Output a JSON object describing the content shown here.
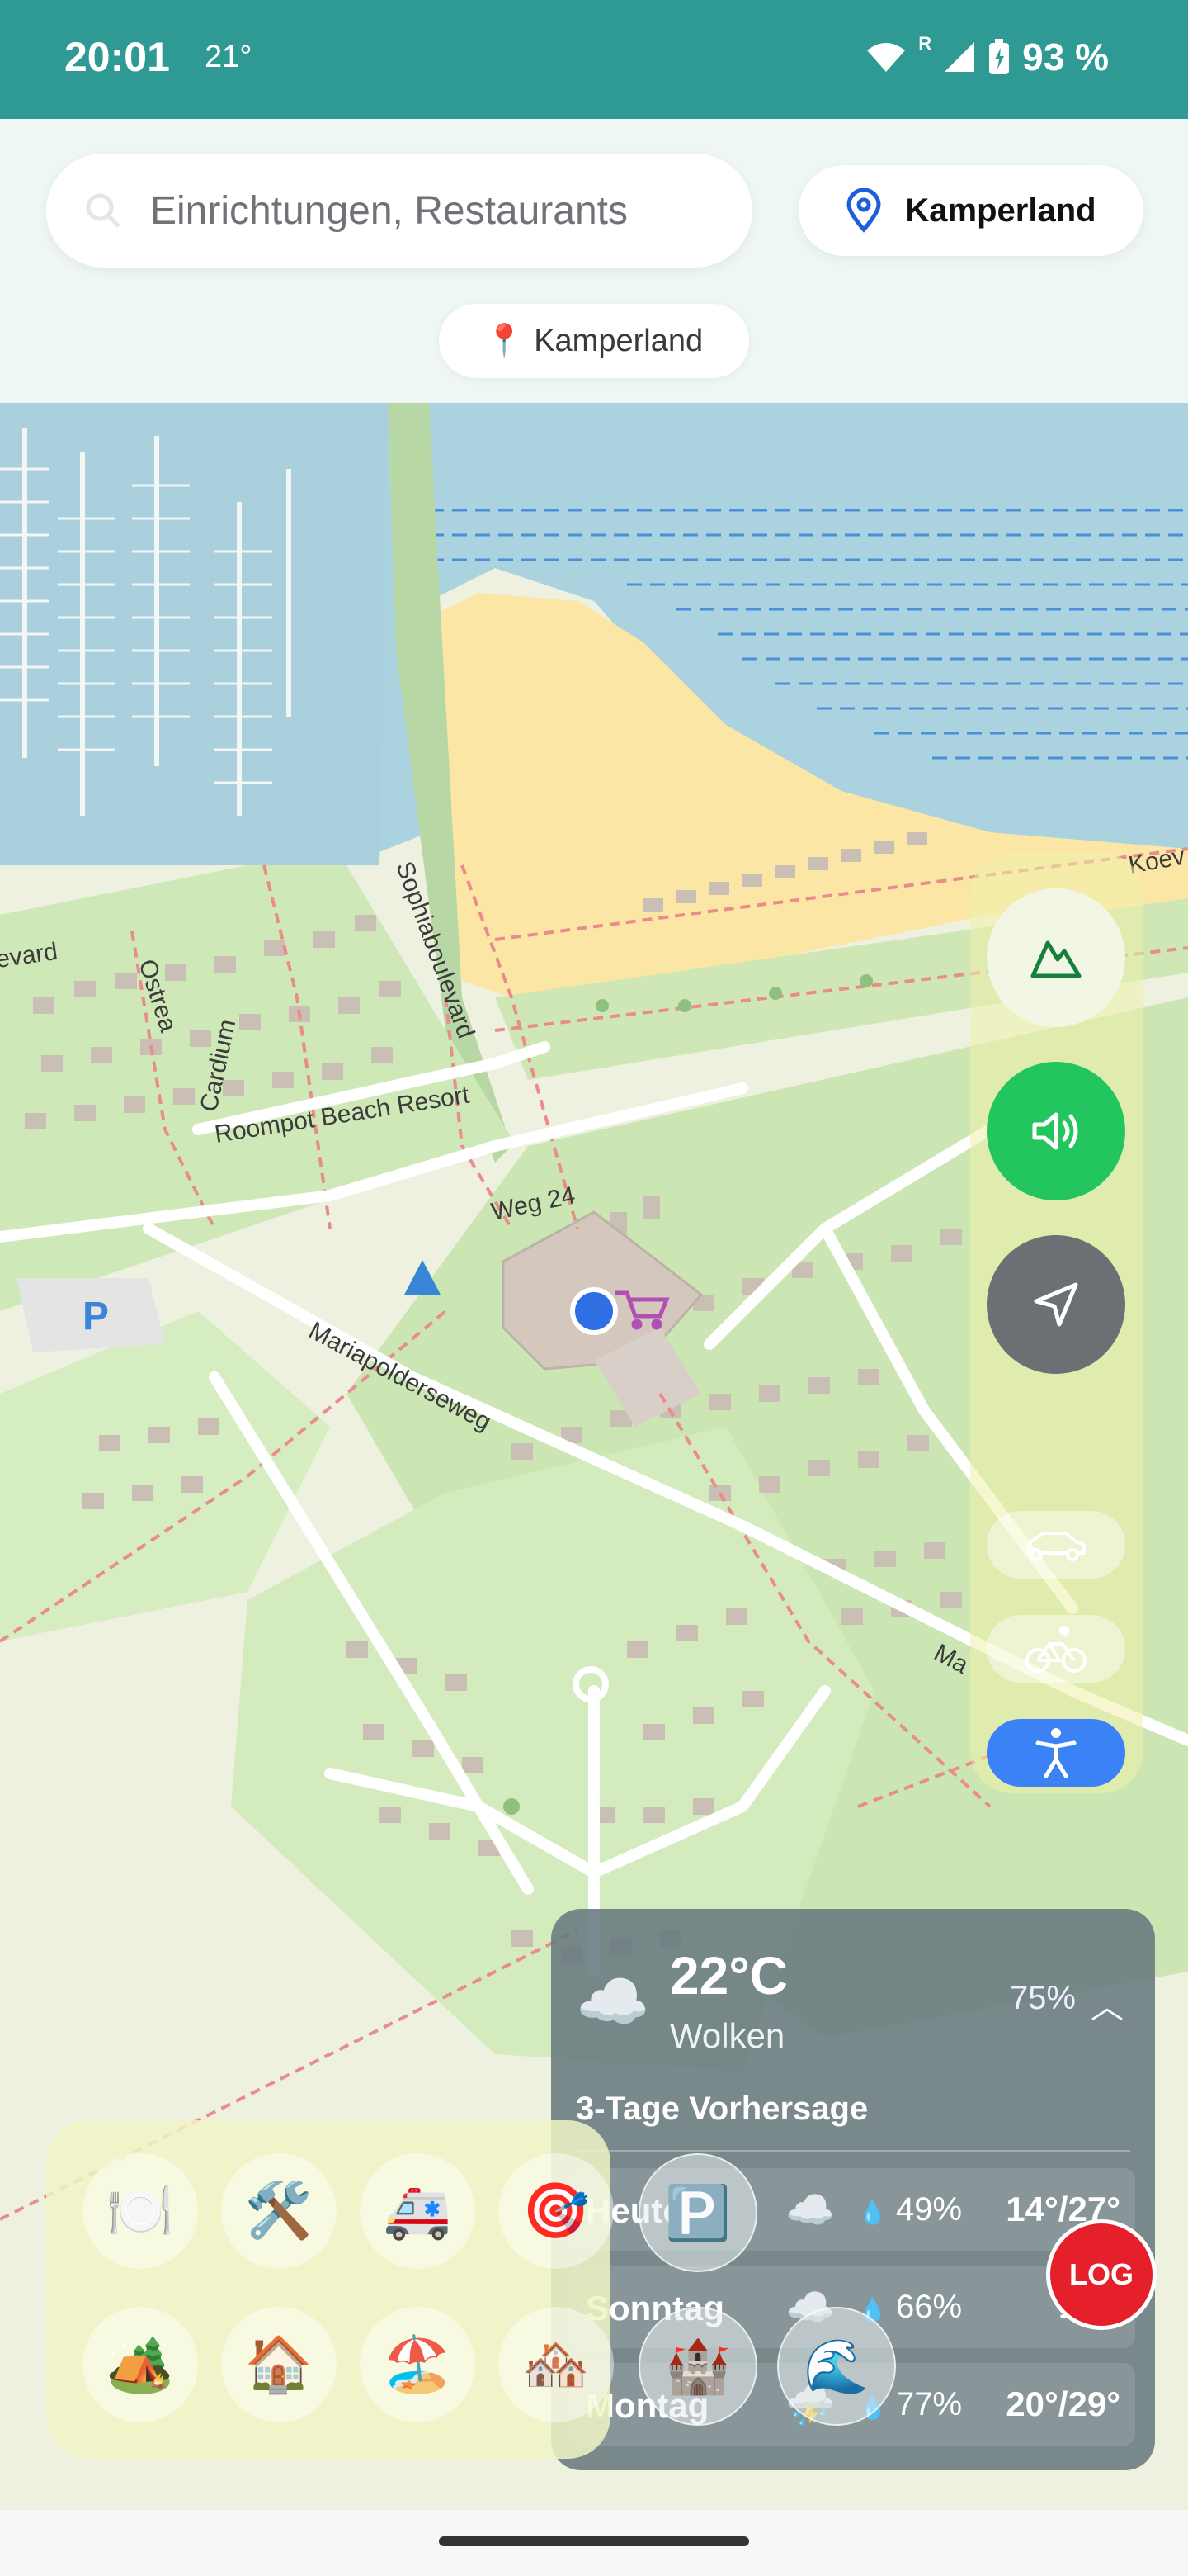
{
  "status_bar": {
    "time": "20:01",
    "temperature": "21°",
    "network": "R",
    "battery": "93 %"
  },
  "header": {
    "search_placeholder": "Einrichtungen, Restaurants",
    "location_button_label": "Kamperland",
    "location_chip": "Kamperland"
  },
  "map": {
    "street_labels": [
      "Sophiaboulevard",
      "levard",
      "Ostrea",
      "Cardium",
      "Roompot Beach Resort",
      "Weg 24",
      "Mariapolderseweg",
      "Koev",
      "Ma"
    ],
    "poi_icons": [
      "parking-icon",
      "campsite-icon",
      "shopping-cart-icon",
      "current-location-dot"
    ]
  },
  "controls": {
    "buttons": [
      "terrain-icon",
      "sound-icon",
      "navigation-arrow-icon"
    ],
    "travel_modes": [
      "car-icon",
      "bicycle-icon",
      "walking-accessibility-icon"
    ],
    "active_mode": "walking-accessibility-icon",
    "colors": {
      "sound": "#22c55e",
      "nav": "#6b7074",
      "active_mode": "#3b82f6"
    }
  },
  "weather": {
    "current_temp": "22°C",
    "current_desc": "Wolken",
    "humidity": "75%",
    "forecast_title": "3-Tage Vorhersage",
    "forecast": [
      {
        "day": "Heute",
        "icon": "☁️",
        "rain": "49%",
        "range": "14°/27°"
      },
      {
        "day": "Sonntag",
        "icon": "☁️",
        "rain": "66%",
        "range": "16°/"
      },
      {
        "day": "Montag",
        "icon": "⛈️",
        "rain": "77%",
        "range": "20°/29°"
      }
    ]
  },
  "log_button": "LOG",
  "categories": {
    "row1": [
      "🍽️",
      "🛠️",
      "🚑",
      "🎯"
    ],
    "row2": [
      "🏕️",
      "🏠",
      "🏖️",
      "🏘️"
    ],
    "floating": [
      "🅿️",
      "🏰",
      "🌊"
    ]
  }
}
